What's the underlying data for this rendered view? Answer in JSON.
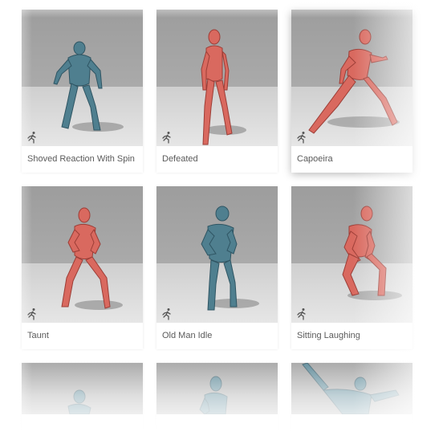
{
  "colors": {
    "red_model": "#d9695f",
    "blue_model": "#4f7f8f",
    "label_text": "#5a5a5a"
  },
  "icon": "running-figure-icon",
  "cards": [
    {
      "label": "Shoved Reaction With Spin",
      "model": "blue"
    },
    {
      "label": "Defeated",
      "model": "red"
    },
    {
      "label": "Capoeira",
      "model": "red"
    },
    {
      "label": "Taunt",
      "model": "red"
    },
    {
      "label": "Old Man Idle",
      "model": "blue"
    },
    {
      "label": "Sitting Laughing",
      "model": "red"
    },
    {
      "label": "",
      "model": "blue"
    },
    {
      "label": "",
      "model": "blue"
    },
    {
      "label": "",
      "model": "blue"
    }
  ]
}
